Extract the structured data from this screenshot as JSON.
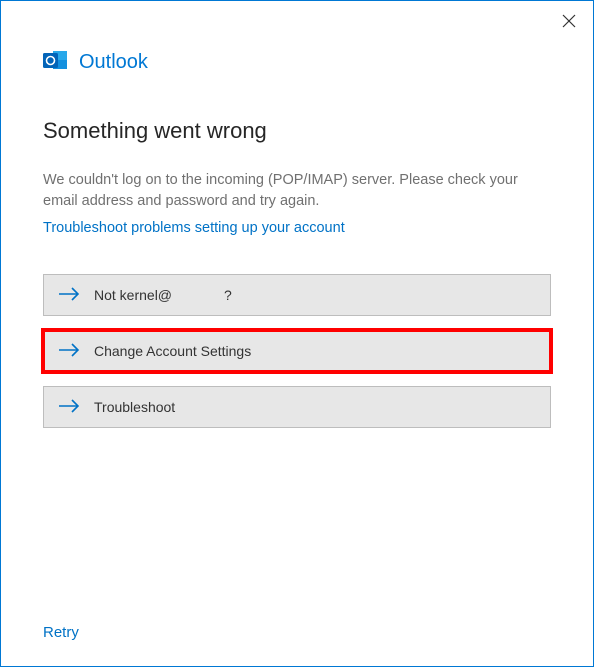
{
  "brand": {
    "name": "Outlook"
  },
  "heading": "Something went wrong",
  "description": "We couldn't log on to the incoming (POP/IMAP) server. Please check your email address and password and try again.",
  "help_link": "Troubleshoot problems setting up your account",
  "options": {
    "not_account_prefix": "Not kernel@",
    "not_account_suffix": " ?",
    "change_settings": "Change Account Settings",
    "troubleshoot": "Troubleshoot"
  },
  "footer": {
    "retry": "Retry"
  },
  "colors": {
    "accent": "#0078d4",
    "link": "#0072c6",
    "highlight": "#ff0000"
  }
}
